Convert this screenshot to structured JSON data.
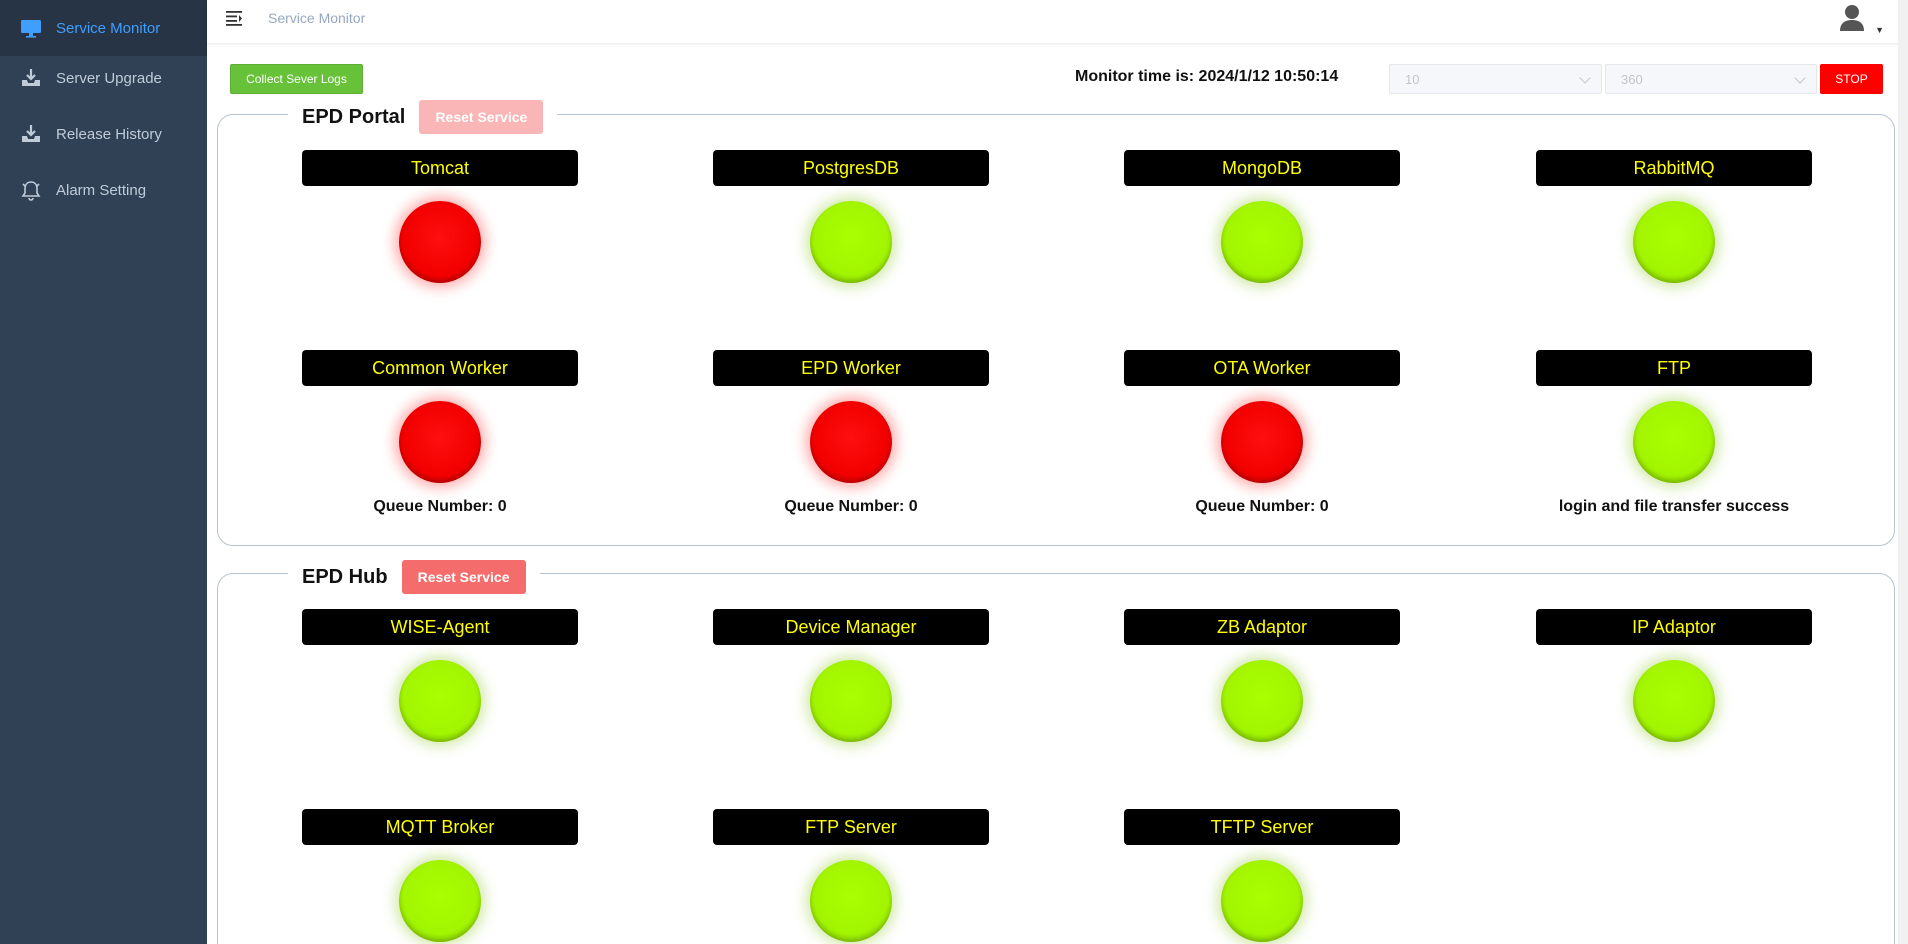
{
  "sidebar": {
    "items": [
      {
        "label": "Service Monitor",
        "icon": "monitor-icon",
        "active": true
      },
      {
        "label": "Server Upgrade",
        "icon": "download-tray-icon"
      },
      {
        "label": "Release History",
        "icon": "download-tray-icon"
      },
      {
        "label": "Alarm Setting",
        "icon": "bell-icon"
      }
    ]
  },
  "header": {
    "breadcrumb": "Service Monitor"
  },
  "toolbar": {
    "collect_label": "Collect Sever Logs",
    "monitor_time_label": "Monitor time is: 2024/1/12 10:50:14",
    "select1_value": "10",
    "select2_value": "360",
    "stop_label": "STOP"
  },
  "colors": {
    "status_up": "#a4f900",
    "status_down": "#ff0000",
    "label_text": "#ffff00",
    "sidebar_bg": "#304156",
    "active_nav": "#409eff"
  },
  "portal": {
    "title": "EPD Portal",
    "reset_label": "Reset Service",
    "services": [
      {
        "name": "Tomcat",
        "status": "down",
        "note": ""
      },
      {
        "name": "PostgresDB",
        "status": "up",
        "note": ""
      },
      {
        "name": "MongoDB",
        "status": "up",
        "note": ""
      },
      {
        "name": "RabbitMQ",
        "status": "up",
        "note": ""
      },
      {
        "name": "Common Worker",
        "status": "down",
        "note": "Queue Number: 0"
      },
      {
        "name": "EPD Worker",
        "status": "down",
        "note": "Queue Number: 0"
      },
      {
        "name": "OTA Worker",
        "status": "down",
        "note": "Queue Number: 0"
      },
      {
        "name": "FTP",
        "status": "up",
        "note": "login and file transfer success"
      }
    ]
  },
  "hub": {
    "title": "EPD Hub",
    "reset_label": "Reset Service",
    "services": [
      {
        "name": "WISE-Agent",
        "status": "up"
      },
      {
        "name": "Device Manager",
        "status": "up"
      },
      {
        "name": "ZB Adaptor",
        "status": "up"
      },
      {
        "name": "IP Adaptor",
        "status": "up"
      },
      {
        "name": "MQTT Broker",
        "status": "up"
      },
      {
        "name": "FTP Server",
        "status": "up"
      },
      {
        "name": "TFTP Server",
        "status": "up"
      }
    ]
  }
}
